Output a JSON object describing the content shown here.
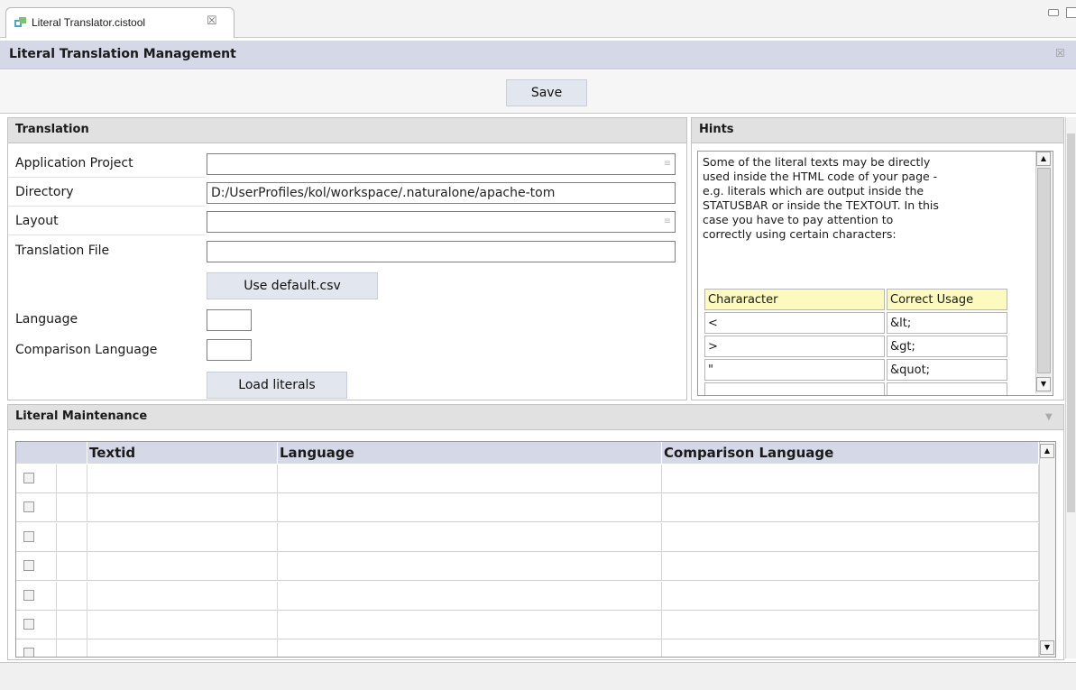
{
  "tab": {
    "label": "Literal Translator.cistool",
    "close": "☒"
  },
  "header": {
    "title": "Literal Translation Management",
    "close": "☒"
  },
  "toolbar": {
    "save_label": "Save"
  },
  "translation": {
    "title": "Translation",
    "application_project": {
      "label": "Application Project",
      "value": ""
    },
    "directory": {
      "label": "Directory",
      "value": "D:/UserProfiles/kol/workspace/.naturalone/apache-tom"
    },
    "layout": {
      "label": "Layout",
      "value": ""
    },
    "translation_file": {
      "label": "Translation File",
      "value": ""
    },
    "use_default_label": "Use default.csv",
    "language": {
      "label": "Language",
      "value": ""
    },
    "comparison_language": {
      "label": "Comparison Language",
      "value": ""
    },
    "load_literals_label": "Load literals"
  },
  "hints": {
    "title": "Hints",
    "lines": [
      "Some of the literal texts may be directly",
      "used inside the HTML code of your page -",
      "e.g. literals which are output inside the",
      "STATUSBAR or inside the TEXTOUT. In this",
      "case you have to pay attention to",
      "correctly using certain  characters:"
    ],
    "table": {
      "headers": [
        "Chararacter",
        "Correct Usage"
      ],
      "rows": [
        [
          "<",
          "&lt;"
        ],
        [
          ">",
          "&gt;"
        ],
        [
          "\"",
          "&quot;"
        ]
      ]
    }
  },
  "maintenance": {
    "title": "Literal Maintenance",
    "columns": [
      "Textid",
      "Language",
      "Comparison Language"
    ],
    "row_count": 7
  },
  "colors": {
    "header_bg": "#d5d8e6",
    "section_bg": "#e1e1e1",
    "button_bg": "#e2e6ee",
    "hint_header_bg": "#fdfac0"
  }
}
